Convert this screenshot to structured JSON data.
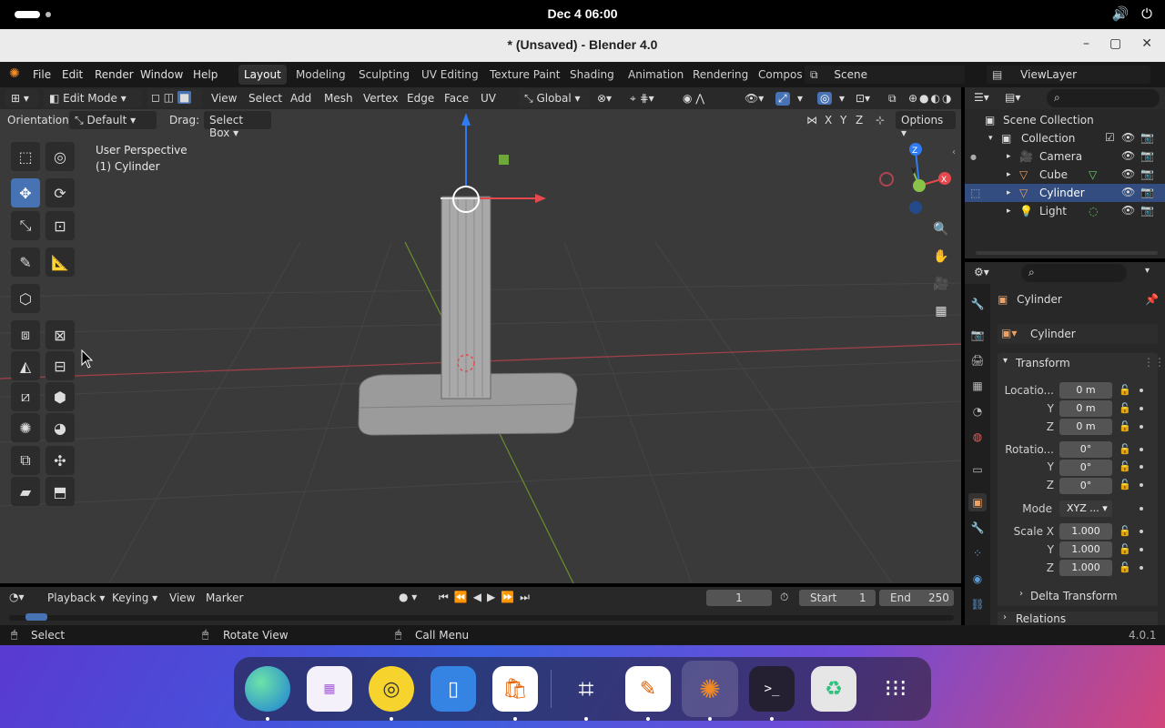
{
  "system": {
    "clock": "Dec 4  06:00"
  },
  "window": {
    "title": "* (Unsaved) - Blender 4.0",
    "minimize": "–",
    "maximize": "▢",
    "close": "✕"
  },
  "menu": {
    "items": [
      "File",
      "Edit",
      "Render",
      "Window",
      "Help"
    ],
    "workspaces": [
      "Layout",
      "Modeling",
      "Sculpting",
      "UV Editing",
      "Texture Paint",
      "Shading",
      "Animation",
      "Rendering",
      "Compos"
    ],
    "active_workspace": "Layout",
    "scene": "Scene",
    "view_layer": "ViewLayer"
  },
  "viewport": {
    "mode": "Edit Mode",
    "header_menus": [
      "View",
      "Select",
      "Add",
      "Mesh",
      "Vertex",
      "Edge",
      "Face",
      "UV"
    ],
    "transform_orientation": "Global",
    "orientation_label": "Orientation:",
    "orientation_value": "Default",
    "drag_label": "Drag:",
    "drag_value": "Select Box",
    "mirror_axes": [
      "X",
      "Y",
      "Z"
    ],
    "options_label": "Options",
    "info_line1": "User Perspective",
    "info_line2": "(1) Cylinder",
    "gizmo_axes": [
      "Z",
      "Y",
      "X"
    ]
  },
  "outliner": {
    "root": "Scene Collection",
    "collection": "Collection",
    "objects": [
      {
        "name": "Camera",
        "icon": "camera-icon"
      },
      {
        "name": "Cube",
        "icon": "mesh-icon"
      },
      {
        "name": "Cylinder",
        "icon": "mesh-icon",
        "selected": true
      },
      {
        "name": "Light",
        "icon": "light-icon"
      }
    ]
  },
  "properties": {
    "object_name": "Cylinder",
    "data_name": "Cylinder",
    "transform_panel": "Transform",
    "location_label": "Locatio...",
    "location": [
      "0 m",
      "0 m",
      "0 m"
    ],
    "rotation_label": "Rotatio...",
    "rotation": [
      "0°",
      "0°",
      "0°"
    ],
    "mode_label": "Mode",
    "mode_value": "XYZ ...",
    "scale_label": "Scale X",
    "scale": [
      "1.000",
      "1.000",
      "1.000"
    ],
    "axis_y": "Y",
    "axis_z": "Z",
    "delta_panel": "Delta Transform",
    "relations_panel": "Relations"
  },
  "timeline": {
    "menus": [
      "Playback",
      "Keying",
      "View",
      "Marker"
    ],
    "current_frame": "1",
    "start_label": "Start",
    "start": "1",
    "end_label": "End",
    "end": "250"
  },
  "status": {
    "select": "Select",
    "rotate": "Rotate View",
    "call_menu": "Call Menu",
    "version": "4.0.1"
  },
  "colors": {
    "accent": "#4772b3",
    "selected_row": "#334d80",
    "x_axis": "#e5484d",
    "y_axis": "#8bc34a",
    "z_axis": "#2f7bf2"
  }
}
